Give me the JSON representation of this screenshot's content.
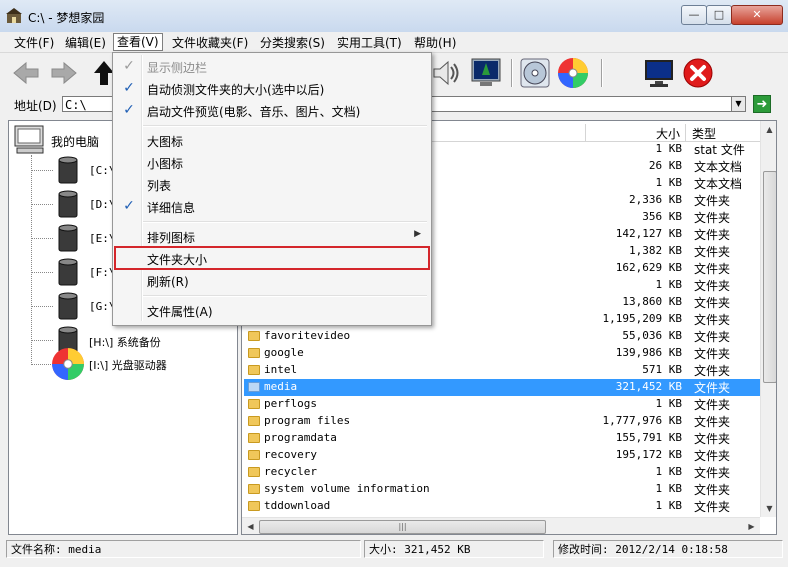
{
  "window": {
    "title": "C:\\ - 梦想家园",
    "controls": {
      "minimize": "—",
      "maximize": "□",
      "close": "✕"
    }
  },
  "menubar": [
    {
      "label": "文件(F)"
    },
    {
      "label": "编辑(E)"
    },
    {
      "label": "查看(V)"
    },
    {
      "label": "文件收藏夹(F)"
    },
    {
      "label": "分类搜索(S)"
    },
    {
      "label": "实用工具(T)"
    },
    {
      "label": "帮助(H)"
    }
  ],
  "address": {
    "label": "地址(D)",
    "value": "C:\\"
  },
  "view_menu": {
    "items": [
      {
        "label": "显示侧边栏",
        "checked": true,
        "disabled": true
      },
      {
        "label": "自动侦测文件夹的大小(选中以后)",
        "checked": true
      },
      {
        "label": "启动文件预览(电影、音乐、图片、文档)",
        "checked": true
      },
      {
        "label": "大图标"
      },
      {
        "label": "小图标"
      },
      {
        "label": "列表"
      },
      {
        "label": "详细信息",
        "checked": true
      },
      {
        "label": "排列图标",
        "submenu": true
      },
      {
        "label": "文件夹大小",
        "highlighted": true
      },
      {
        "label": "刷新(R)"
      },
      {
        "label": "文件属性(A)"
      }
    ],
    "check_mark": "✓",
    "submenu_arrow": "▶"
  },
  "tree": {
    "root": "我的电脑",
    "drives": [
      {
        "label": "[C:\\]",
        "icon": "drive-icon"
      },
      {
        "label": "[D:\\]",
        "icon": "drive-icon"
      },
      {
        "label": "[E:\\]",
        "icon": "drive-icon"
      },
      {
        "label": "[F:\\]",
        "icon": "drive-icon"
      },
      {
        "label": "[G:\\]",
        "icon": "drive-icon"
      },
      {
        "label": "[H:\\] 系统备份",
        "icon": "drive-icon"
      },
      {
        "label": "[I:\\] 光盘驱动器",
        "icon": "cd-drive-icon"
      }
    ]
  },
  "list": {
    "columns": {
      "size": "大小",
      "type": "类型"
    },
    "rows": [
      {
        "name": "",
        "size": "1 KB",
        "type": "stat 文件",
        "folder": false
      },
      {
        "name": "",
        "size": "26 KB",
        "type": "文本文档",
        "folder": false
      },
      {
        "name": "",
        "size": "1 KB",
        "type": "文本文档",
        "folder": false
      },
      {
        "name": "",
        "size": "2,336 KB",
        "type": "文件夹",
        "folder": false
      },
      {
        "name": "",
        "size": "356 KB",
        "type": "文件夹",
        "folder": false
      },
      {
        "name": "",
        "size": "142,127 KB",
        "type": "文件夹",
        "folder": false
      },
      {
        "name": "",
        "size": "1,382 KB",
        "type": "文件夹",
        "folder": false
      },
      {
        "name": "",
        "size": "162,629 KB",
        "type": "文件夹",
        "folder": false
      },
      {
        "name": "",
        "size": "1 KB",
        "type": "文件夹",
        "folder": false
      },
      {
        "name": "",
        "size": "13,860 KB",
        "type": "文件夹",
        "folder": false
      },
      {
        "name": "",
        "size": "1,195,209 KB",
        "type": "文件夹",
        "folder": false
      },
      {
        "name": "favoritevideo",
        "size": "55,036 KB",
        "type": "文件夹",
        "folder": true
      },
      {
        "name": "google",
        "size": "139,986 KB",
        "type": "文件夹",
        "folder": true
      },
      {
        "name": "intel",
        "size": "571 KB",
        "type": "文件夹",
        "folder": true
      },
      {
        "name": "media",
        "size": "321,452 KB",
        "type": "文件夹",
        "folder": true,
        "selected": true
      },
      {
        "name": "perflogs",
        "size": "1 KB",
        "type": "文件夹",
        "folder": true
      },
      {
        "name": "program files",
        "size": "1,777,976 KB",
        "type": "文件夹",
        "folder": true
      },
      {
        "name": "programdata",
        "size": "155,791 KB",
        "type": "文件夹",
        "folder": true
      },
      {
        "name": "recovery",
        "size": "195,172 KB",
        "type": "文件夹",
        "folder": true
      },
      {
        "name": "recycler",
        "size": "1 KB",
        "type": "文件夹",
        "folder": true
      },
      {
        "name": "system volume information",
        "size": "1 KB",
        "type": "文件夹",
        "folder": true
      },
      {
        "name": "tddownload",
        "size": "1 KB",
        "type": "文件夹",
        "folder": true
      }
    ]
  },
  "status": {
    "filename": "文件名称: media",
    "size": "大小: 321,452 KB",
    "modified": "修改时间: 2012/2/14 0:18:58"
  },
  "colors": {
    "selection": "#3399ff",
    "highlight_box": "#d4262b",
    "check": "#1f5fb5"
  }
}
